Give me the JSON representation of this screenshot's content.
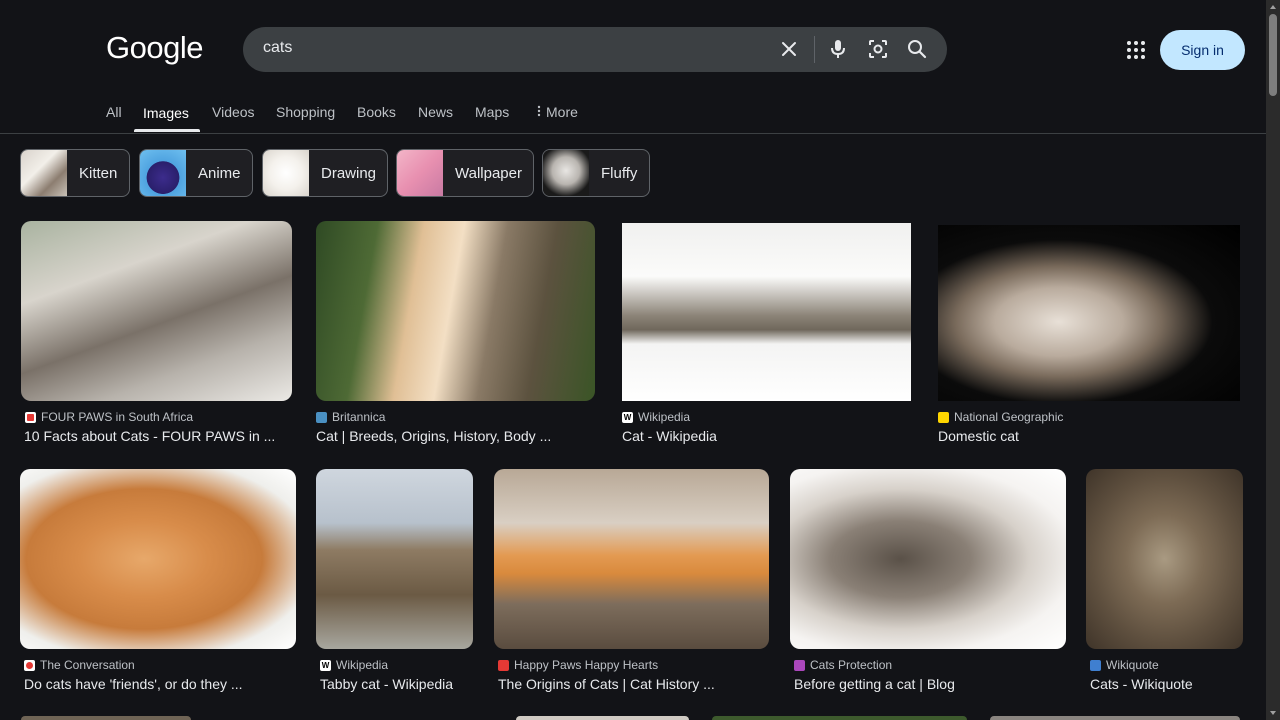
{
  "header": {
    "logo": "Google",
    "search_value": "cats",
    "sign_in_label": "Sign in"
  },
  "tabs": [
    {
      "label": "All"
    },
    {
      "label": "Images"
    },
    {
      "label": "Videos"
    },
    {
      "label": "Shopping"
    },
    {
      "label": "Books"
    },
    {
      "label": "News"
    },
    {
      "label": "Maps"
    },
    {
      "label": "More"
    }
  ],
  "active_tab": "Images",
  "chips": [
    {
      "label": "Kitten"
    },
    {
      "label": "Anime"
    },
    {
      "label": "Drawing"
    },
    {
      "label": "Wallpaper"
    },
    {
      "label": "Fluffy"
    }
  ],
  "results": [
    {
      "source": "FOUR PAWS in South Africa",
      "title": "10 Facts about Cats - FOUR PAWS in ...",
      "favicon_color": "#e53935"
    },
    {
      "source": "Britannica",
      "title": "Cat | Breeds, Origins, History, Body ...",
      "favicon_color": "#4a90c2"
    },
    {
      "source": "Wikipedia",
      "title": "Cat - Wikipedia",
      "favicon_color": "#ffffff"
    },
    {
      "source": "National Geographic",
      "title": "Domestic cat",
      "favicon_color": "#ffd600"
    },
    {
      "source": "The Conversation",
      "title": "Do cats have 'friends', or do they ...",
      "favicon_color": "#e53935"
    },
    {
      "source": "Wikipedia",
      "title": "Tabby cat - Wikipedia",
      "favicon_color": "#ffffff"
    },
    {
      "source": "Happy Paws Happy Hearts",
      "title": "The Origins of Cats | Cat History ...",
      "favicon_color": "#e53935"
    },
    {
      "source": "Cats Protection",
      "title": "Before getting a cat | Blog",
      "favicon_color": "#ab47bc"
    },
    {
      "source": "Wikiquote",
      "title": "Cats - Wikiquote",
      "favicon_color": "#3f7fd0"
    }
  ]
}
